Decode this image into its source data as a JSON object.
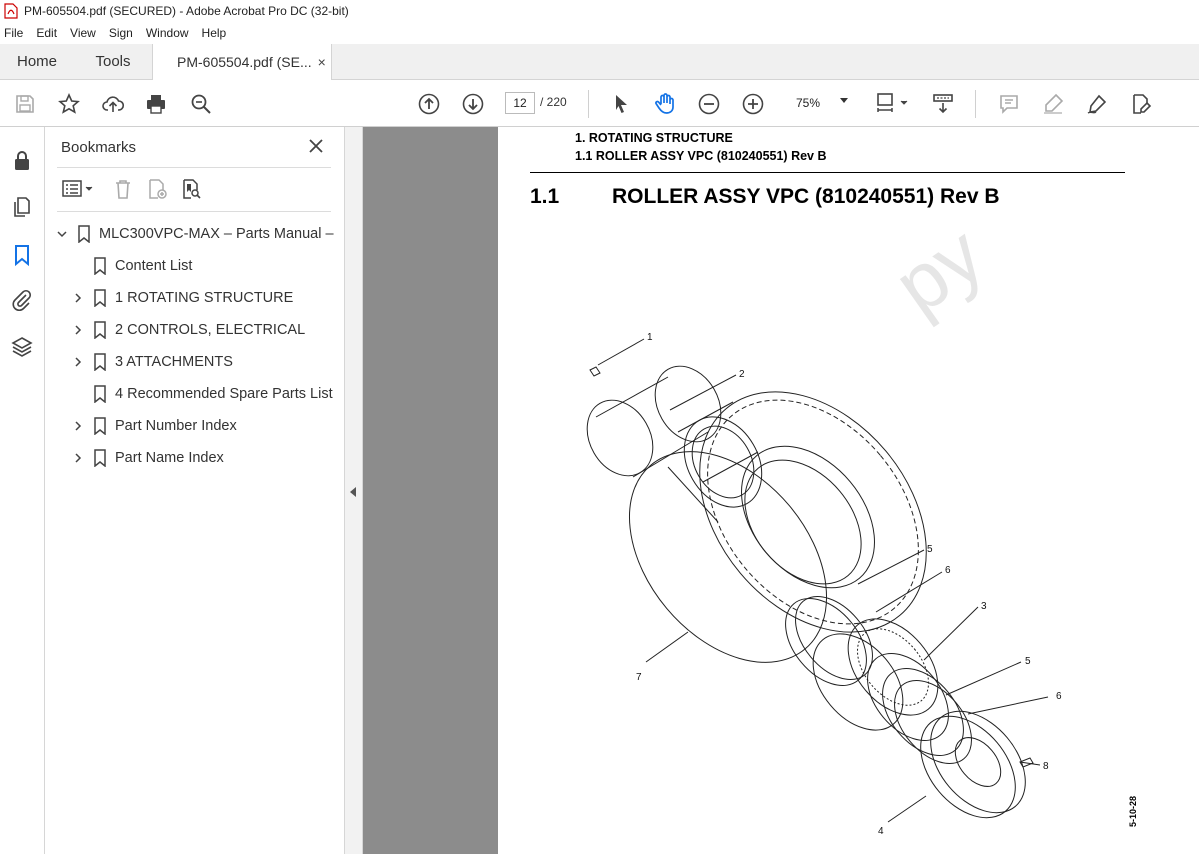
{
  "window": {
    "title": "PM-605504.pdf (SECURED) - Adobe Acrobat Pro DC (32-bit)"
  },
  "menu": [
    "File",
    "Edit",
    "View",
    "Sign",
    "Window",
    "Help"
  ],
  "tabs": {
    "home": "Home",
    "tools": "Tools",
    "doc": "PM-605504.pdf (SE...",
    "close": "×"
  },
  "toolbar": {
    "page_current": "12",
    "page_total": "/ 220",
    "zoom": "75%"
  },
  "bookmarks": {
    "title": "Bookmarks",
    "root": "MLC300VPC-MAX – Parts Manual –",
    "items": [
      {
        "label": "Content List",
        "expandable": false
      },
      {
        "label": "1 ROTATING STRUCTURE",
        "expandable": true
      },
      {
        "label": "2 CONTROLS, ELECTRICAL",
        "expandable": true
      },
      {
        "label": "3 ATTACHMENTS",
        "expandable": true
      },
      {
        "label": "4 Recommended Spare Parts List",
        "expandable": false
      },
      {
        "label": "Part Number Index",
        "expandable": true
      },
      {
        "label": "Part Name Index",
        "expandable": true
      }
    ]
  },
  "document": {
    "header_line1": "1. ROTATING STRUCTURE",
    "header_line2": "1.1 ROLLER ASSY VPC (810240551) Rev B",
    "section_number": "1.1",
    "section_title": "ROLLER ASSY VPC (810240551) Rev B",
    "watermark": "py",
    "callouts": [
      "1",
      "2",
      "5",
      "6",
      "3",
      "7",
      "5",
      "6",
      "8",
      "4"
    ],
    "side_code": "5-10-28"
  },
  "colors": {
    "accent": "#1473e6",
    "doc_bg": "#8c8c8c"
  }
}
